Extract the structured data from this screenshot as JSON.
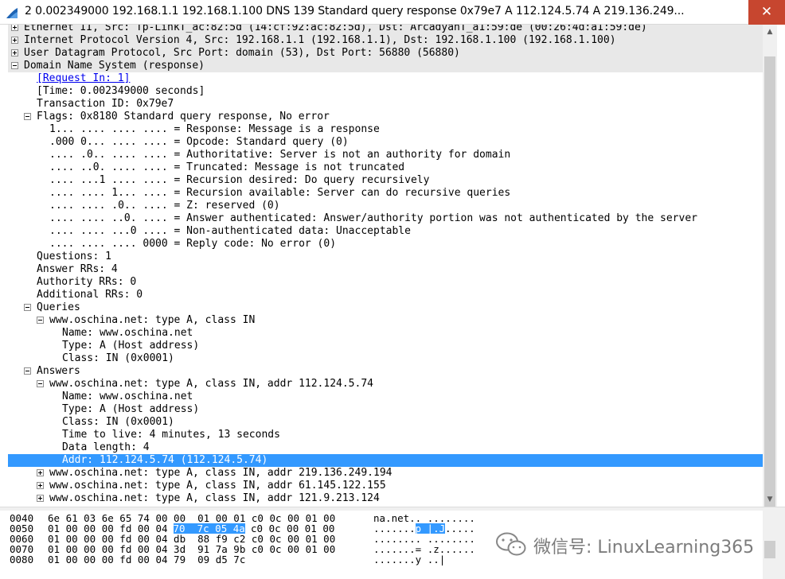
{
  "window": {
    "title": "2 0.002349000 192.168.1.1 192.168.1.100 DNS 139 Standard query response 0x79e7  A 112.124.5.74 A 219.136.249...",
    "close_glyph": "✕"
  },
  "tree": [
    {
      "text": "Ethernet II, Src: Tp-LinkT_ac:82:5d (14:cf:92:ac:82:5d), Dst: ArcadyanT_a1:59:de (00:26:4d:a1:59:de)",
      "indent": 0,
      "toggle": "plus",
      "shaded": true
    },
    {
      "text": "Internet Protocol Version 4, Src: 192.168.1.1 (192.168.1.1), Dst: 192.168.1.100 (192.168.1.100)",
      "indent": 0,
      "toggle": "plus",
      "shaded": true
    },
    {
      "text": "User Datagram Protocol, Src Port: domain (53), Dst Port: 56880 (56880)",
      "indent": 0,
      "toggle": "plus",
      "shaded": true
    },
    {
      "text": "Domain Name System (response)",
      "indent": 0,
      "toggle": "minus",
      "shaded": true
    },
    {
      "text": "[Request In: 1]",
      "indent": 1,
      "link": true
    },
    {
      "text": "[Time: 0.002349000 seconds]",
      "indent": 1
    },
    {
      "text": "Transaction ID: 0x79e7",
      "indent": 1
    },
    {
      "text": "Flags: 0x8180 Standard query response, No error",
      "indent": 1,
      "toggle": "minus"
    },
    {
      "text": "1... .... .... .... = Response: Message is a response",
      "indent": 2
    },
    {
      "text": ".000 0... .... .... = Opcode: Standard query (0)",
      "indent": 2
    },
    {
      "text": ".... .0.. .... .... = Authoritative: Server is not an authority for domain",
      "indent": 2
    },
    {
      "text": ".... ..0. .... .... = Truncated: Message is not truncated",
      "indent": 2
    },
    {
      "text": ".... ...1 .... .... = Recursion desired: Do query recursively",
      "indent": 2
    },
    {
      "text": ".... .... 1... .... = Recursion available: Server can do recursive queries",
      "indent": 2
    },
    {
      "text": ".... .... .0.. .... = Z: reserved (0)",
      "indent": 2
    },
    {
      "text": ".... .... ..0. .... = Answer authenticated: Answer/authority portion was not authenticated by the server",
      "indent": 2
    },
    {
      "text": ".... .... ...0 .... = Non-authenticated data: Unacceptable",
      "indent": 2
    },
    {
      "text": ".... .... .... 0000 = Reply code: No error (0)",
      "indent": 2
    },
    {
      "text": "Questions: 1",
      "indent": 1
    },
    {
      "text": "Answer RRs: 4",
      "indent": 1
    },
    {
      "text": "Authority RRs: 0",
      "indent": 1
    },
    {
      "text": "Additional RRs: 0",
      "indent": 1
    },
    {
      "text": "Queries",
      "indent": 1,
      "toggle": "minus"
    },
    {
      "text": "www.oschina.net: type A, class IN",
      "indent": 2,
      "toggle": "minus"
    },
    {
      "text": "Name: www.oschina.net",
      "indent": 3
    },
    {
      "text": "Type: A (Host address)",
      "indent": 3
    },
    {
      "text": "Class: IN (0x0001)",
      "indent": 3
    },
    {
      "text": "Answers",
      "indent": 1,
      "toggle": "minus"
    },
    {
      "text": "www.oschina.net: type A, class IN, addr 112.124.5.74",
      "indent": 2,
      "toggle": "minus"
    },
    {
      "text": "Name: www.oschina.net",
      "indent": 3
    },
    {
      "text": "Type: A (Host address)",
      "indent": 3
    },
    {
      "text": "Class: IN (0x0001)",
      "indent": 3
    },
    {
      "text": "Time to live: 4 minutes, 13 seconds",
      "indent": 3
    },
    {
      "text": "Data length: 4",
      "indent": 3
    },
    {
      "text": "Addr: 112.124.5.74 (112.124.5.74)",
      "indent": 3,
      "selected": true
    },
    {
      "text": "www.oschina.net: type A, class IN, addr 219.136.249.194",
      "indent": 2,
      "toggle": "plus"
    },
    {
      "text": "www.oschina.net: type A, class IN, addr 61.145.122.155",
      "indent": 2,
      "toggle": "plus"
    },
    {
      "text": "www.oschina.net: type A, class IN, addr 121.9.213.124",
      "indent": 2,
      "toggle": "plus"
    }
  ],
  "hex": [
    {
      "offset": "0040",
      "bytes": "6e 61 03 6e 65 74 00 00  01 00 01 c0 0c 00 01 00",
      "ascii": "na.net.. ........"
    },
    {
      "offset": "0050",
      "bytes_pre": "01 00 00 00 fd 00 04 ",
      "bytes_hl": "70  7c 05 4a",
      "bytes_post": " c0 0c 00 01 00",
      "ascii_pre": ".......",
      "ascii_hl": "p |.J",
      "ascii_post": "....."
    },
    {
      "offset": "0060",
      "bytes": "01 00 00 00 fd 00 04 db  88 f9 c2 c0 0c 00 01 00",
      "ascii": "........ ........"
    },
    {
      "offset": "0070",
      "bytes": "01 00 00 00 fd 00 04 3d  91 7a 9b c0 0c 00 01 00",
      "ascii": ".......= .z......"
    },
    {
      "offset": "0080",
      "bytes": "01 00 00 00 fd 00 04 79  09 d5 7c",
      "ascii": ".......y ..|"
    }
  ],
  "watermark": {
    "text": "微信号: LinuxLearning365"
  },
  "colors": {
    "selection": "#3399ff",
    "close": "#c7462f",
    "shaded": "#e8e8e8"
  }
}
